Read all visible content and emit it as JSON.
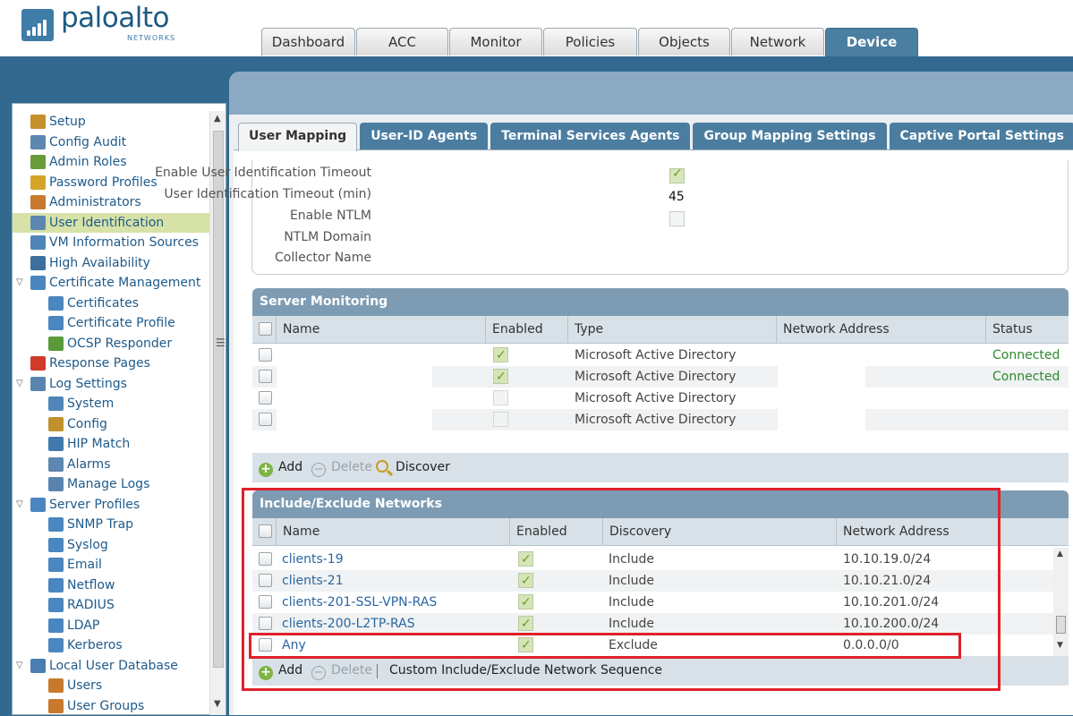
{
  "brand": {
    "name": "paloalto",
    "sub": "NETWORKS",
    "color": "#1e5a82"
  },
  "main_tabs": [
    "Dashboard",
    "ACC",
    "Monitor",
    "Policies",
    "Objects",
    "Network",
    "Device"
  ],
  "active_main_tab": "Device",
  "nav": [
    {
      "label": "Setup",
      "icon": "setup-icon"
    },
    {
      "label": "Config Audit",
      "icon": "config-audit-icon"
    },
    {
      "label": "Admin Roles",
      "icon": "admin-roles-icon"
    },
    {
      "label": "Password Profiles",
      "icon": "key-icon"
    },
    {
      "label": "Administrators",
      "icon": "user-icon"
    },
    {
      "label": "User Identification",
      "icon": "user-id-icon",
      "selected": true
    },
    {
      "label": "VM Information Sources",
      "icon": "monitor-icon"
    },
    {
      "label": "High Availability",
      "icon": "server-icon"
    },
    {
      "label": "Certificate Management",
      "icon": "certificate-icon",
      "expanded": true
    },
    {
      "label": "Certificates",
      "icon": "certificate-icon"
    },
    {
      "label": "Certificate Profile",
      "icon": "certificate-icon"
    },
    {
      "label": "OCSP Responder",
      "icon": "check-icon"
    },
    {
      "label": "Response Pages",
      "icon": "block-icon"
    },
    {
      "label": "Log Settings",
      "icon": "log-icon",
      "expanded": true
    },
    {
      "label": "System",
      "icon": "monitor-icon"
    },
    {
      "label": "Config",
      "icon": "gear-icon"
    },
    {
      "label": "HIP Match",
      "icon": "hip-icon"
    },
    {
      "label": "Alarms",
      "icon": "alarm-icon"
    },
    {
      "label": "Manage Logs",
      "icon": "log-icon"
    },
    {
      "label": "Server Profiles",
      "icon": "server-profile-icon",
      "expanded": true
    },
    {
      "label": "SNMP Trap",
      "icon": "server-profile-icon"
    },
    {
      "label": "Syslog",
      "icon": "server-profile-icon"
    },
    {
      "label": "Email",
      "icon": "server-profile-icon"
    },
    {
      "label": "Netflow",
      "icon": "server-profile-icon"
    },
    {
      "label": "RADIUS",
      "icon": "server-profile-icon"
    },
    {
      "label": "LDAP",
      "icon": "server-profile-icon"
    },
    {
      "label": "Kerberos",
      "icon": "server-profile-icon"
    },
    {
      "label": "Local User Database",
      "icon": "database-icon",
      "expanded": true
    },
    {
      "label": "Users",
      "icon": "user-icon"
    },
    {
      "label": "User Groups",
      "icon": "users-icon"
    }
  ],
  "sub_tabs": [
    "User Mapping",
    "User-ID Agents",
    "Terminal Services Agents",
    "Group Mapping Settings",
    "Captive Portal Settings"
  ],
  "active_sub_tab": "User Mapping",
  "settings": {
    "enable_timeout_label": "Enable User Identification Timeout",
    "enable_timeout": true,
    "timeout_label": "User Identification Timeout (min)",
    "timeout_value": "45",
    "enable_ntlm_label": "Enable NTLM",
    "enable_ntlm": false,
    "ntlm_domain_label": "NTLM Domain",
    "collector_label": "Collector Name"
  },
  "server_monitoring": {
    "title": "Server Monitoring",
    "columns": [
      "Name",
      "Enabled",
      "Type",
      "Network Address",
      "Status"
    ],
    "rows": [
      {
        "name": "",
        "enabled": true,
        "type": "Microsoft Active Directory",
        "address": "",
        "status": "Connected"
      },
      {
        "name": "",
        "enabled": true,
        "type": "Microsoft Active Directory",
        "address": "",
        "status": "Connected"
      },
      {
        "name": "",
        "enabled": false,
        "type": "Microsoft Active Directory",
        "address": "",
        "status": ""
      },
      {
        "name": "",
        "enabled": false,
        "type": "Microsoft Active Directory",
        "address": "",
        "status": ""
      }
    ],
    "toolbar": {
      "add": "Add",
      "delete": "Delete",
      "discover": "Discover"
    }
  },
  "include_exclude": {
    "title": "Include/Exclude Networks",
    "columns": [
      "Name",
      "Enabled",
      "Discovery",
      "Network Address"
    ],
    "rows": [
      {
        "name": "clients-19",
        "enabled": true,
        "discovery": "Include",
        "address": "10.10.19.0/24"
      },
      {
        "name": "clients-21",
        "enabled": true,
        "discovery": "Include",
        "address": "10.10.21.0/24"
      },
      {
        "name": "clients-201-SSL-VPN-RAS",
        "enabled": true,
        "discovery": "Include",
        "address": "10.10.201.0/24"
      },
      {
        "name": "clients-200-L2TP-RAS",
        "enabled": true,
        "discovery": "Include",
        "address": "10.10.200.0/24"
      },
      {
        "name": "Any",
        "enabled": true,
        "discovery": "Exclude",
        "address": "0.0.0.0/0"
      }
    ],
    "toolbar": {
      "add": "Add",
      "delete": "Delete",
      "sequence": "Custom Include/Exclude Network Sequence"
    }
  },
  "colors": {
    "accent": "#33698f",
    "highlight": "#e0202a",
    "selected_nav": "#d7e2a8",
    "connected": "#2b8a2b"
  }
}
